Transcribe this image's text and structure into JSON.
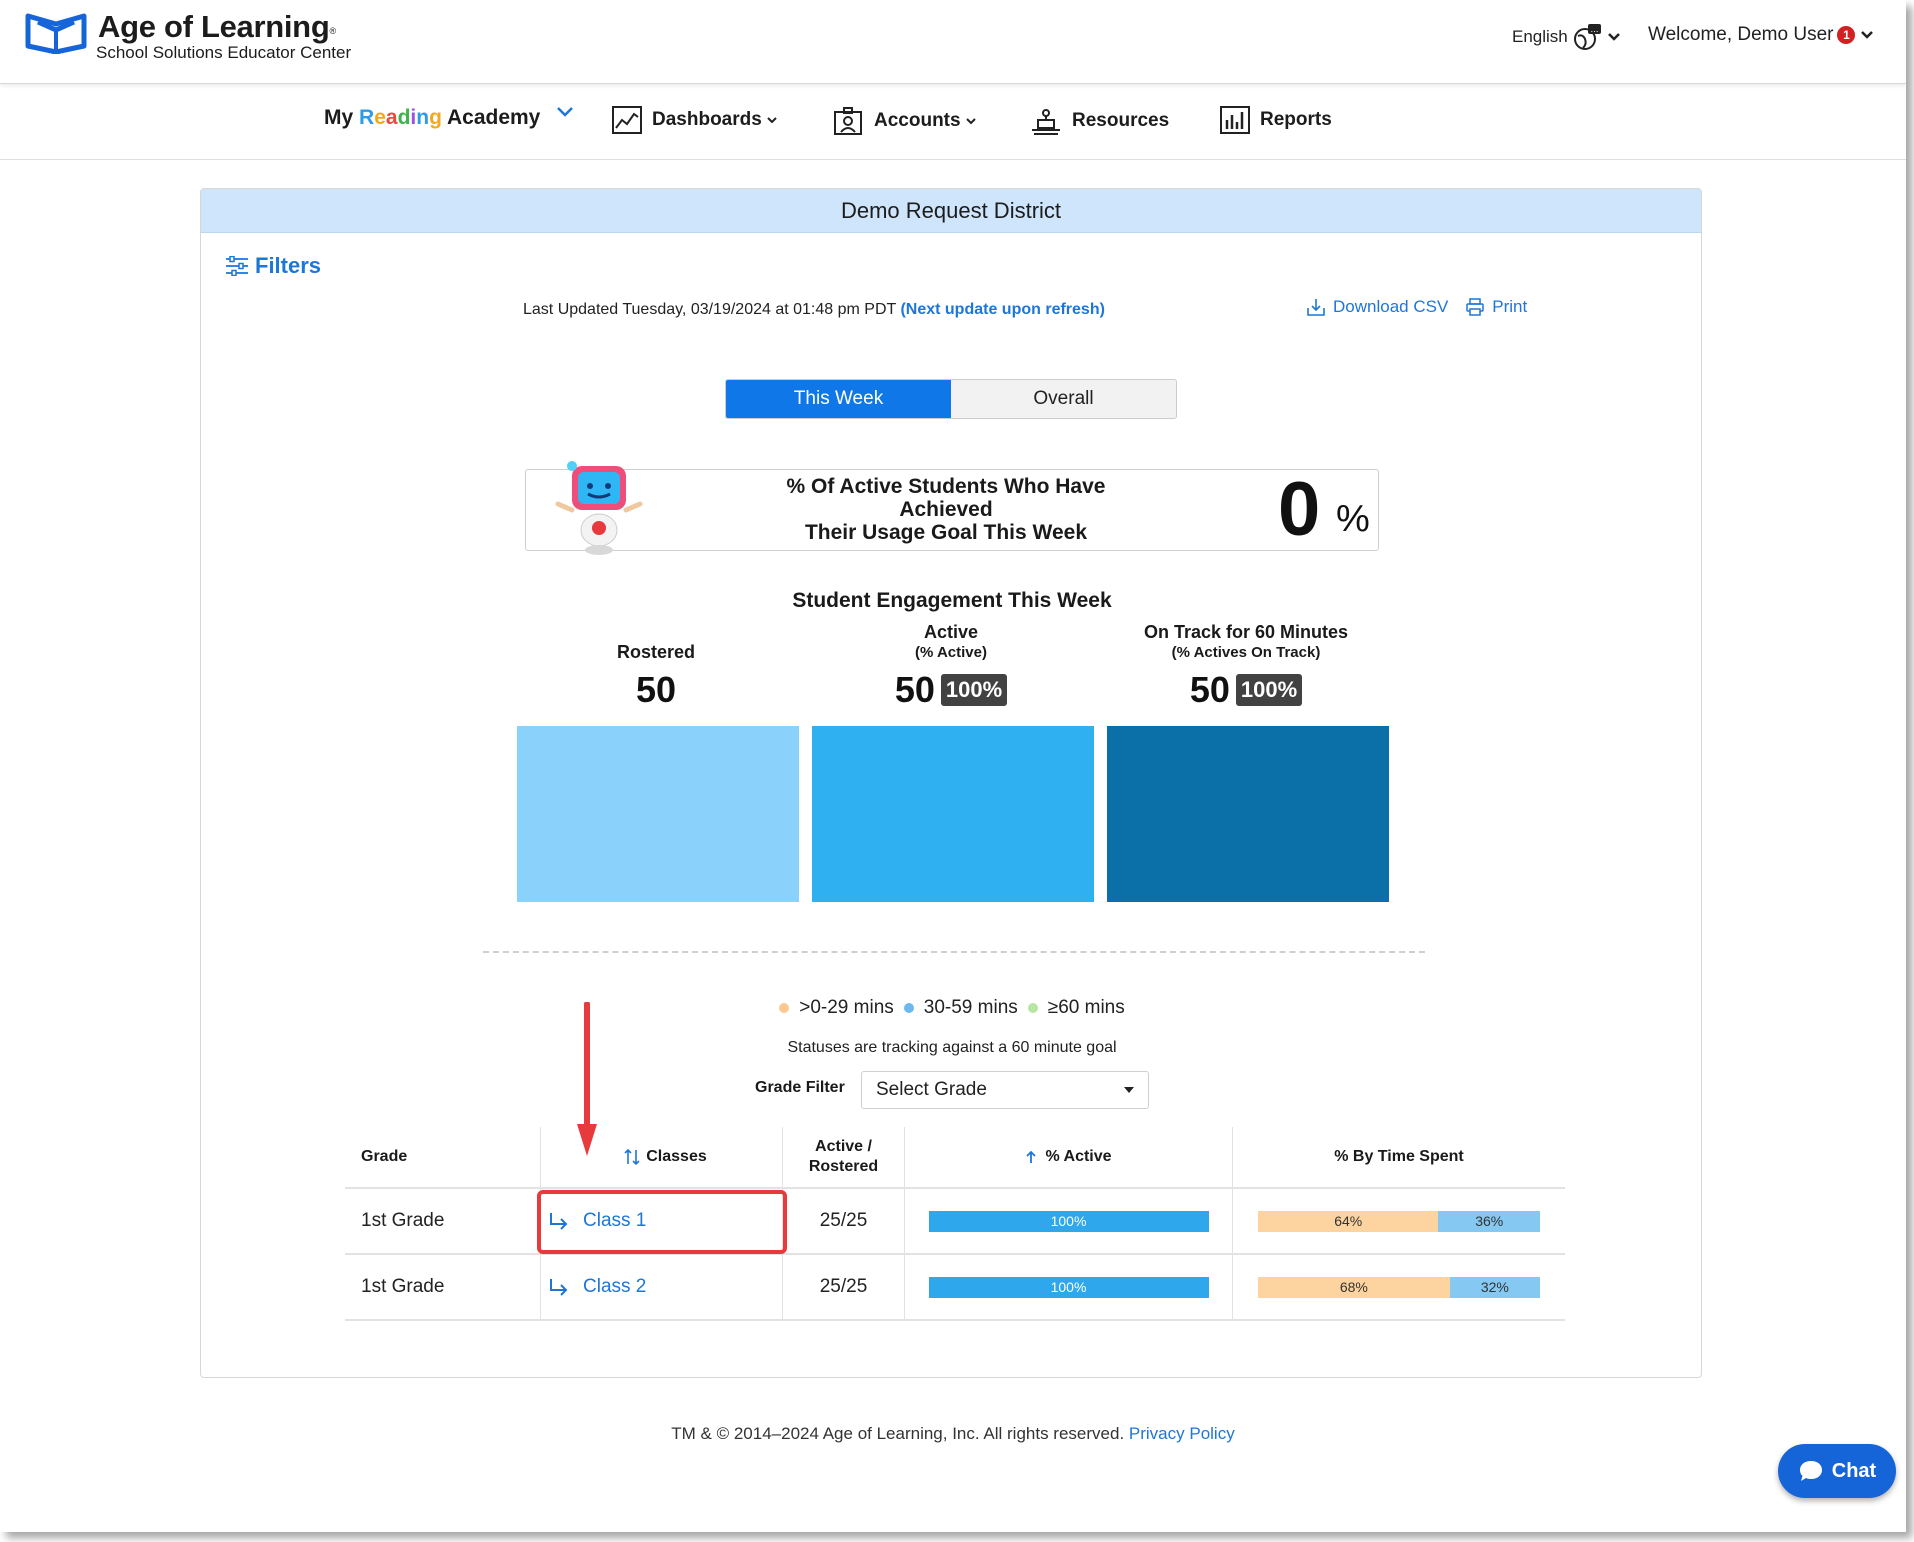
{
  "brand": {
    "title": "Age of Learning",
    "trademark": "®",
    "subtitle": "School Solutions Educator Center"
  },
  "header": {
    "language": "English",
    "welcome": "Welcome, Demo User",
    "notification_count": "1"
  },
  "nav": {
    "product": {
      "my": "My",
      "reading": [
        "R",
        "e",
        "a",
        "d",
        "i",
        "n",
        "g"
      ],
      "academy": "Academy"
    },
    "items": [
      {
        "label": "Dashboards",
        "icon": "chart-icon",
        "has_dropdown": true
      },
      {
        "label": "Accounts",
        "icon": "accounts-icon",
        "has_dropdown": true
      },
      {
        "label": "Resources",
        "icon": "resources-icon",
        "has_dropdown": false
      },
      {
        "label": "Reports",
        "icon": "reports-icon",
        "has_dropdown": false
      }
    ]
  },
  "card": {
    "title": "Demo Request District",
    "filters_label": "Filters",
    "last_updated": "Last Updated Tuesday, 03/19/2024 at 01:48 pm PDT",
    "next_update": "(Next update upon refresh)",
    "download_csv": "Download CSV",
    "print": "Print",
    "toggle": {
      "active": "This Week",
      "inactive": "Overall"
    },
    "goal": {
      "text_line1": "% Of Active Students Who Have Achieved",
      "text_line2": "Their Usage Goal This Week",
      "value": "0",
      "unit": "%"
    },
    "engagement": {
      "title": "Student Engagement This Week",
      "metrics": [
        {
          "title": "Rostered",
          "subtitle": "",
          "value": "50",
          "badge": "",
          "color": "#8ad2fb"
        },
        {
          "title": "Active",
          "subtitle": "(% Active)",
          "value": "50",
          "badge": "100%",
          "color": "#2fb0f0"
        },
        {
          "title": "On Track for 60 Minutes",
          "subtitle": "(% Actives On Track)",
          "value": "50",
          "badge": "100%",
          "color": "#0c70a8"
        }
      ]
    },
    "legend": [
      {
        "label": ">0-29 mins",
        "color": "#fdc890"
      },
      {
        "label": "30-59 mins",
        "color": "#6cb9ef"
      },
      {
        "label": "≥60 mins",
        "color": "#b6e6a2"
      }
    ],
    "status_note": "Statuses are tracking against a 60 minute goal",
    "grade_filter": {
      "label": "Grade Filter",
      "value": "Select Grade"
    },
    "table": {
      "headers": {
        "grade": "Grade",
        "classes": "Classes",
        "active_line1": "Active /",
        "active_line2": "Rostered",
        "pct_active": "% Active",
        "time_spent": "% By Time Spent"
      },
      "rows": [
        {
          "grade": "1st Grade",
          "class": "Class 1",
          "ratio": "25/25",
          "pct_active": "100%",
          "pct_active_value": 100,
          "t1": "64%",
          "t1_value": 64,
          "t2": "36%",
          "t2_value": 36
        },
        {
          "grade": "1st Grade",
          "class": "Class 2",
          "ratio": "25/25",
          "pct_active": "100%",
          "pct_active_value": 100,
          "t1": "68%",
          "t1_value": 68,
          "t2": "32%",
          "t2_value": 32
        }
      ]
    }
  },
  "footer": {
    "copyright": "TM & © 2014–2024 Age of Learning, Inc. All rights reserved.",
    "privacy": "Privacy Policy"
  },
  "chat": {
    "label": "Chat"
  },
  "colors": {
    "accent": "#1077e8",
    "link": "#1d76d8",
    "highlight": "#e8393c"
  }
}
